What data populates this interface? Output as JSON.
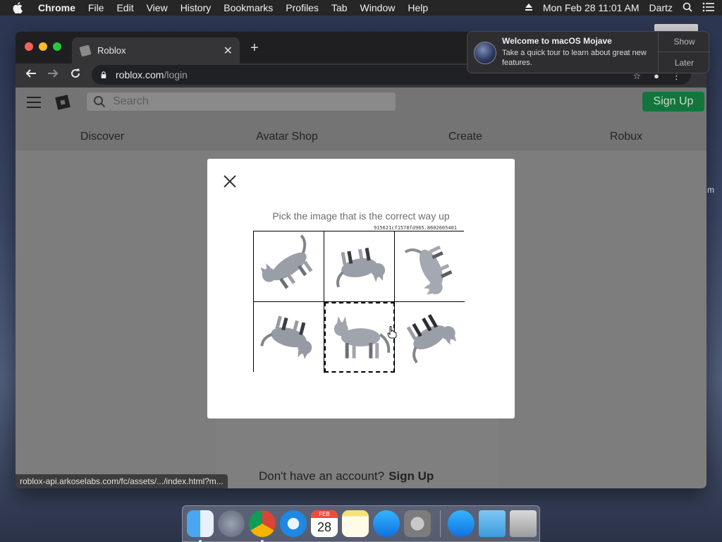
{
  "menubar": {
    "app_name": "Chrome",
    "items": [
      "File",
      "Edit",
      "View",
      "History",
      "Bookmarks",
      "Profiles",
      "Tab",
      "Window",
      "Help"
    ],
    "datetime": "Mon Feb 28  11:01 AM",
    "user": "Dartz"
  },
  "browser": {
    "tab_title": "Roblox",
    "url_host": "roblox.com",
    "url_path": "/login",
    "status_url": "roblox-api.arkoselabs.com/fc/assets/.../index.html?m..."
  },
  "roblox": {
    "search_placeholder": "Search",
    "signup_button": "Sign Up",
    "nav": [
      "Discover",
      "Avatar Shop",
      "Create",
      "Robux"
    ],
    "no_account_text": "Don't have an account?",
    "no_account_link": "Sign Up"
  },
  "captcha": {
    "prompt": "Pick the image that is the correct way up",
    "challenge_id": "915621cf1578fd965.8602605401",
    "selected_index": 4,
    "tiles": [
      {
        "subject": "cat-figure",
        "rotation": "tilted-sideways"
      },
      {
        "subject": "cat-figure",
        "rotation": "upside-down"
      },
      {
        "subject": "cat-figure",
        "rotation": "tilted"
      },
      {
        "subject": "cat-figure",
        "rotation": "upside-down"
      },
      {
        "subject": "cat-figure",
        "rotation": "upright"
      },
      {
        "subject": "cat-figure",
        "rotation": "upside-down"
      }
    ]
  },
  "notification": {
    "title": "Welcome to macOS Mojave",
    "body": "Take a quick tour to learn about great new features.",
    "show": "Show",
    "later": "Later"
  },
  "dock": {
    "calendar_month": "FEB",
    "calendar_day": "28",
    "icons": [
      "finder-icon",
      "launchpad-icon",
      "chrome-icon",
      "safari-icon",
      "calendar-icon",
      "notes-icon",
      "app-store-icon",
      "system-preferences-icon",
      "app-store-icon",
      "downloads-folder-icon",
      "trash-icon"
    ]
  },
  "colors": {
    "signup_green": "#12763c",
    "menubar": "#262626",
    "overlay_page": "#7d7d7d"
  }
}
